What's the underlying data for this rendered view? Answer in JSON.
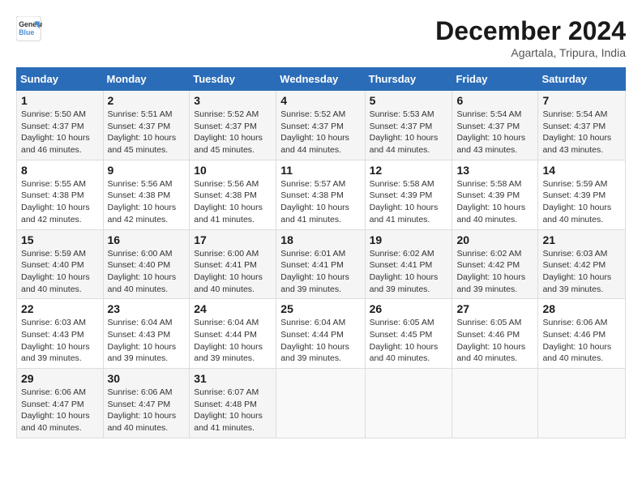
{
  "logo": {
    "line1": "General",
    "line2": "Blue"
  },
  "title": "December 2024",
  "subtitle": "Agartala, Tripura, India",
  "days_header": [
    "Sunday",
    "Monday",
    "Tuesday",
    "Wednesday",
    "Thursday",
    "Friday",
    "Saturday"
  ],
  "weeks": [
    [
      {
        "day": "1",
        "sunrise": "5:50 AM",
        "sunset": "4:37 PM",
        "daylight": "10 hours and 46 minutes."
      },
      {
        "day": "2",
        "sunrise": "5:51 AM",
        "sunset": "4:37 PM",
        "daylight": "10 hours and 45 minutes."
      },
      {
        "day": "3",
        "sunrise": "5:52 AM",
        "sunset": "4:37 PM",
        "daylight": "10 hours and 45 minutes."
      },
      {
        "day": "4",
        "sunrise": "5:52 AM",
        "sunset": "4:37 PM",
        "daylight": "10 hours and 44 minutes."
      },
      {
        "day": "5",
        "sunrise": "5:53 AM",
        "sunset": "4:37 PM",
        "daylight": "10 hours and 44 minutes."
      },
      {
        "day": "6",
        "sunrise": "5:54 AM",
        "sunset": "4:37 PM",
        "daylight": "10 hours and 43 minutes."
      },
      {
        "day": "7",
        "sunrise": "5:54 AM",
        "sunset": "4:37 PM",
        "daylight": "10 hours and 43 minutes."
      }
    ],
    [
      {
        "day": "8",
        "sunrise": "5:55 AM",
        "sunset": "4:38 PM",
        "daylight": "10 hours and 42 minutes."
      },
      {
        "day": "9",
        "sunrise": "5:56 AM",
        "sunset": "4:38 PM",
        "daylight": "10 hours and 42 minutes."
      },
      {
        "day": "10",
        "sunrise": "5:56 AM",
        "sunset": "4:38 PM",
        "daylight": "10 hours and 41 minutes."
      },
      {
        "day": "11",
        "sunrise": "5:57 AM",
        "sunset": "4:38 PM",
        "daylight": "10 hours and 41 minutes."
      },
      {
        "day": "12",
        "sunrise": "5:58 AM",
        "sunset": "4:39 PM",
        "daylight": "10 hours and 41 minutes."
      },
      {
        "day": "13",
        "sunrise": "5:58 AM",
        "sunset": "4:39 PM",
        "daylight": "10 hours and 40 minutes."
      },
      {
        "day": "14",
        "sunrise": "5:59 AM",
        "sunset": "4:39 PM",
        "daylight": "10 hours and 40 minutes."
      }
    ],
    [
      {
        "day": "15",
        "sunrise": "5:59 AM",
        "sunset": "4:40 PM",
        "daylight": "10 hours and 40 minutes."
      },
      {
        "day": "16",
        "sunrise": "6:00 AM",
        "sunset": "4:40 PM",
        "daylight": "10 hours and 40 minutes."
      },
      {
        "day": "17",
        "sunrise": "6:00 AM",
        "sunset": "4:41 PM",
        "daylight": "10 hours and 40 minutes."
      },
      {
        "day": "18",
        "sunrise": "6:01 AM",
        "sunset": "4:41 PM",
        "daylight": "10 hours and 39 minutes."
      },
      {
        "day": "19",
        "sunrise": "6:02 AM",
        "sunset": "4:41 PM",
        "daylight": "10 hours and 39 minutes."
      },
      {
        "day": "20",
        "sunrise": "6:02 AM",
        "sunset": "4:42 PM",
        "daylight": "10 hours and 39 minutes."
      },
      {
        "day": "21",
        "sunrise": "6:03 AM",
        "sunset": "4:42 PM",
        "daylight": "10 hours and 39 minutes."
      }
    ],
    [
      {
        "day": "22",
        "sunrise": "6:03 AM",
        "sunset": "4:43 PM",
        "daylight": "10 hours and 39 minutes."
      },
      {
        "day": "23",
        "sunrise": "6:04 AM",
        "sunset": "4:43 PM",
        "daylight": "10 hours and 39 minutes."
      },
      {
        "day": "24",
        "sunrise": "6:04 AM",
        "sunset": "4:44 PM",
        "daylight": "10 hours and 39 minutes."
      },
      {
        "day": "25",
        "sunrise": "6:04 AM",
        "sunset": "4:44 PM",
        "daylight": "10 hours and 39 minutes."
      },
      {
        "day": "26",
        "sunrise": "6:05 AM",
        "sunset": "4:45 PM",
        "daylight": "10 hours and 40 minutes."
      },
      {
        "day": "27",
        "sunrise": "6:05 AM",
        "sunset": "4:46 PM",
        "daylight": "10 hours and 40 minutes."
      },
      {
        "day": "28",
        "sunrise": "6:06 AM",
        "sunset": "4:46 PM",
        "daylight": "10 hours and 40 minutes."
      }
    ],
    [
      {
        "day": "29",
        "sunrise": "6:06 AM",
        "sunset": "4:47 PM",
        "daylight": "10 hours and 40 minutes."
      },
      {
        "day": "30",
        "sunrise": "6:06 AM",
        "sunset": "4:47 PM",
        "daylight": "10 hours and 40 minutes."
      },
      {
        "day": "31",
        "sunrise": "6:07 AM",
        "sunset": "4:48 PM",
        "daylight": "10 hours and 41 minutes."
      },
      null,
      null,
      null,
      null
    ]
  ]
}
